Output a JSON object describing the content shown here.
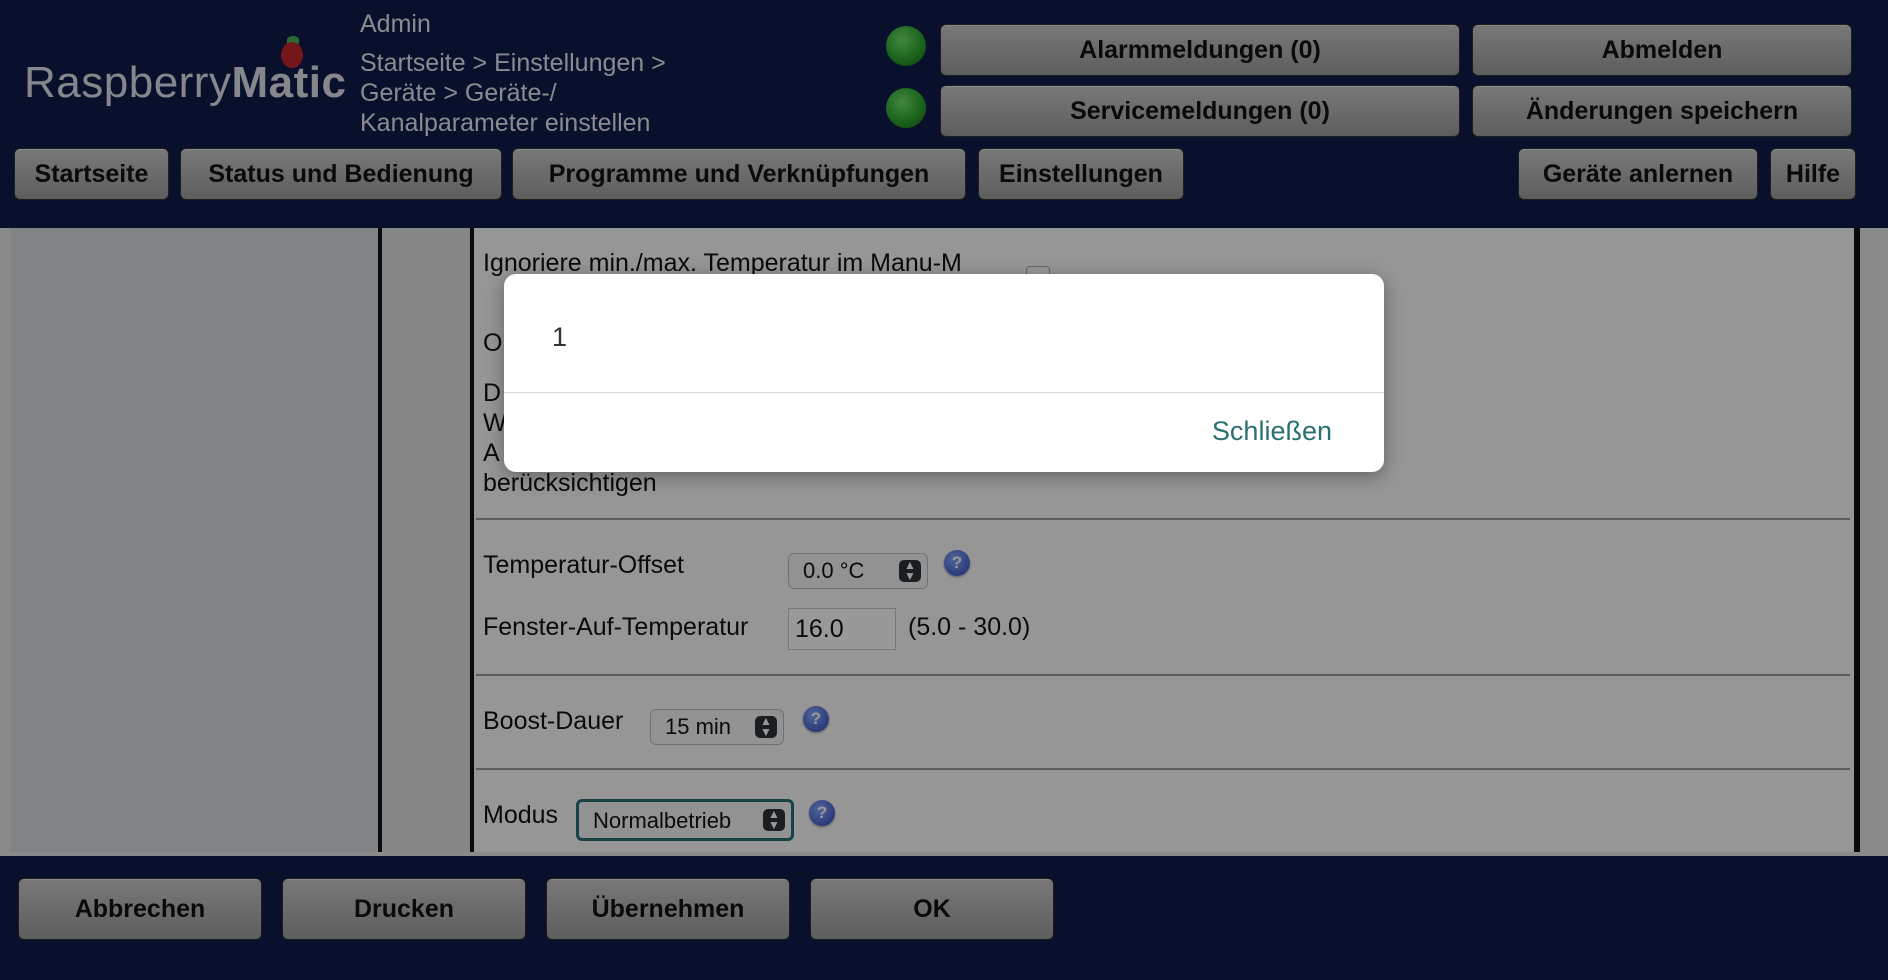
{
  "header": {
    "logo_text_light": "Raspberry",
    "logo_text_bold": "Matic",
    "user": "Admin",
    "breadcrumb": "Startseite > Einstellungen > Geräte > Geräte-/ Kanalparameter einstellen",
    "alarm_button": "Alarmmeldungen (0)",
    "service_button": "Servicemeldungen (0)",
    "logout_button": "Abmelden",
    "save_changes_button": "Änderungen speichern"
  },
  "nav": {
    "items": [
      {
        "label": "Startseite"
      },
      {
        "label": "Status und Bedienung"
      },
      {
        "label": "Programme und Verknüpfungen"
      },
      {
        "label": "Einstellungen"
      }
    ],
    "teach_in": "Geräte anlernen",
    "help": "Hilfe"
  },
  "params": {
    "ignore_minmax_label": "Ignoriere min./max. Temperatur im Manu-M",
    "o_label": "O",
    "d_lines": [
      "D",
      "W",
      "A",
      "berücksichtigen"
    ],
    "temp_offset_label": "Temperatur-Offset",
    "temp_offset_value": "0.0 °C",
    "window_open_label": "Fenster-Auf-Temperatur",
    "window_open_value": "16.0",
    "window_open_range": "(5.0 - 30.0)",
    "boost_label": "Boost-Dauer",
    "boost_value": "15 min",
    "mode_label": "Modus",
    "mode_value": "Normalbetrieb"
  },
  "modal": {
    "body": "1",
    "close": "Schließen"
  },
  "footer": {
    "cancel": "Abbrechen",
    "print": "Drucken",
    "apply": "Übernehmen",
    "ok": "OK"
  },
  "colors": {
    "header_bg": "#0e1b48",
    "link_teal": "#2a7071"
  }
}
